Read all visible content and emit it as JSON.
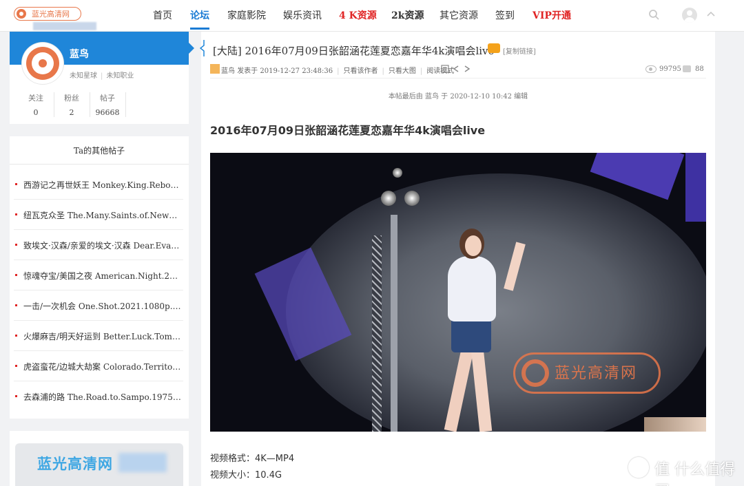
{
  "logo": {
    "text": "蓝光高清网"
  },
  "nav": {
    "items": [
      {
        "label": "首页"
      },
      {
        "label": "论坛"
      },
      {
        "label": "家庭影院"
      },
      {
        "label": "娱乐资讯"
      },
      {
        "label": "4 K资源"
      },
      {
        "label": "2k资源"
      },
      {
        "label": "其它资源"
      },
      {
        "label": "签到"
      },
      {
        "label": "VIP开通"
      }
    ],
    "active_index": 1
  },
  "profile": {
    "name": "蓝鸟",
    "zodiac": "未知星球",
    "job": "未知职业",
    "stats": [
      {
        "label": "关注",
        "value": "0"
      },
      {
        "label": "粉丝",
        "value": "2"
      },
      {
        "label": "帖子",
        "value": "96668"
      }
    ]
  },
  "other_posts": {
    "title": "Ta的其他帖子",
    "items": [
      "西游记之再世妖王 Monkey.King.Reborn.2...",
      "纽瓦克众圣 The.Many.Saints.of.Newark.20...",
      "致埃文·汉森/亲爱的埃文·汉森 Dear.Evan....",
      "惊魂夺宝/美国之夜 American.Night.2021.1...",
      "一击/一次机会 One.Shot.2021.1080p.BluR...",
      "火爆麻吉/明天好运到 Better.Luck.Tomorro...",
      "虎盗蛮花/边城大劫案 Colorado.Territory.1...",
      "去森浦的路 The.Road.to.Sampo.1975.1080..."
    ]
  },
  "ad": {
    "text": "蓝光高清网"
  },
  "post": {
    "title": "[大陆] 2016年07月09日张韶涵花莲夏恋嘉年华4k演唱会live",
    "copy_link": "[复制链接]",
    "author": "蓝鸟",
    "posted": "发表于 2019-12-27 23:48:36",
    "only_author": "只看该作者",
    "only_big_image": "只看大图",
    "read_mode": "阅读模式",
    "views": "99795",
    "replies": "88",
    "edited_note": "本帖最后由 蓝鸟 于 2020-12-10 10:42 编辑",
    "heading": "2016年07月09日张韶涵花莲夏恋嘉年华4k演唱会live",
    "image_watermark": "蓝光高清网",
    "specs": [
      {
        "label": "视频格式：",
        "value": "4K—MP4"
      },
      {
        "label": "视频大小：",
        "value": "10.4G"
      }
    ]
  },
  "corner_watermark": "值 什么值得买",
  "colors": {
    "accent": "#1f86d9",
    "logo_orange": "#e8774a",
    "red": "#e02424"
  }
}
